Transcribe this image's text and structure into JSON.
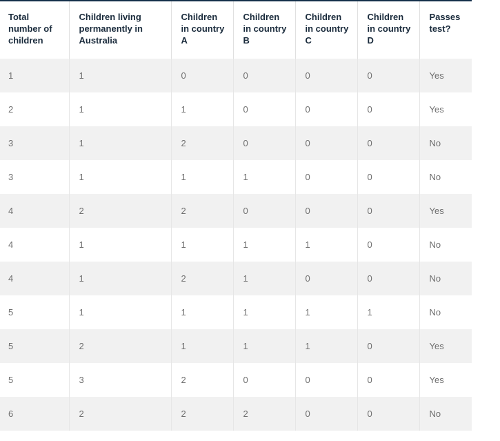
{
  "table": {
    "columns": [
      {
        "key": "total",
        "label": "Total number of children"
      },
      {
        "key": "permanent_au",
        "label": "Children living permanently in Australia"
      },
      {
        "key": "country_a",
        "label": "Children in country A"
      },
      {
        "key": "country_b",
        "label": "Children in country B"
      },
      {
        "key": "country_c",
        "label": "Children in country C"
      },
      {
        "key": "country_d",
        "label": "Children in country D"
      },
      {
        "key": "passes",
        "label": "Passes test?"
      }
    ],
    "rows": [
      {
        "total": "1",
        "permanent_au": "1",
        "country_a": "0",
        "country_b": "0",
        "country_c": "0",
        "country_d": "0",
        "passes": "Yes"
      },
      {
        "total": "2",
        "permanent_au": "1",
        "country_a": "1",
        "country_b": "0",
        "country_c": "0",
        "country_d": "0",
        "passes": "Yes"
      },
      {
        "total": "3",
        "permanent_au": "1",
        "country_a": "2",
        "country_b": "0",
        "country_c": "0",
        "country_d": "0",
        "passes": "No"
      },
      {
        "total": "3",
        "permanent_au": "1",
        "country_a": "1",
        "country_b": "1",
        "country_c": "0",
        "country_d": "0",
        "passes": "No"
      },
      {
        "total": "4",
        "permanent_au": "2",
        "country_a": "2",
        "country_b": "0",
        "country_c": "0",
        "country_d": "0",
        "passes": "Yes"
      },
      {
        "total": "4",
        "permanent_au": "1",
        "country_a": "1",
        "country_b": "1",
        "country_c": "1",
        "country_d": "0",
        "passes": "No"
      },
      {
        "total": "4",
        "permanent_au": "1",
        "country_a": "2",
        "country_b": "1",
        "country_c": "0",
        "country_d": "0",
        "passes": "No"
      },
      {
        "total": "5",
        "permanent_au": "1",
        "country_a": "1",
        "country_b": "1",
        "country_c": "1",
        "country_d": "1",
        "passes": "No"
      },
      {
        "total": "5",
        "permanent_au": "2",
        "country_a": "1",
        "country_b": "1",
        "country_c": "1",
        "country_d": "0",
        "passes": "Yes"
      },
      {
        "total": "5",
        "permanent_au": "3",
        "country_a": "2",
        "country_b": "0",
        "country_c": "0",
        "country_d": "0",
        "passes": "Yes"
      },
      {
        "total": "6",
        "permanent_au": "2",
        "country_a": "2",
        "country_b": "2",
        "country_c": "0",
        "country_d": "0",
        "passes": "No"
      }
    ]
  },
  "style": {
    "top_border_color": "#14304a",
    "header_text_color": "#1a2b3c",
    "cell_text_color": "#6f6f6f",
    "stripe_color": "#f1f1f1",
    "divider_color": "#e6e6e6"
  }
}
